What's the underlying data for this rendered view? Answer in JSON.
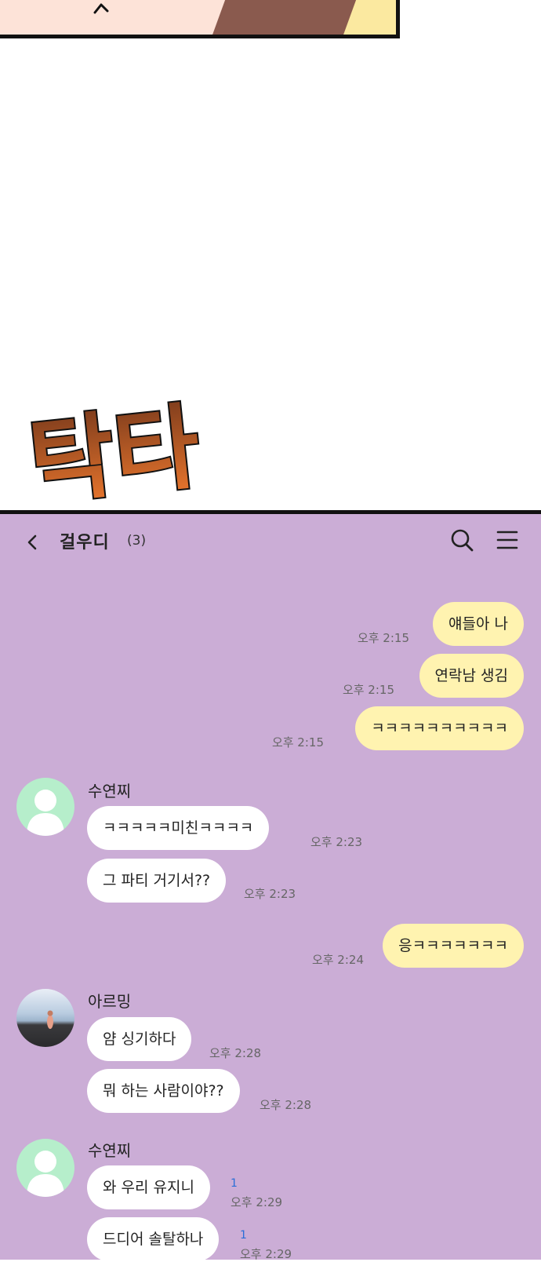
{
  "sfx_text": "탁타",
  "chat": {
    "title": "걸우디",
    "member_count": "(3)"
  },
  "icons": {
    "back": "chevron-left-icon",
    "search": "search-icon",
    "menu": "hamburger-menu-icon"
  },
  "colors": {
    "chat_background": "#cbadd6",
    "my_bubble": "#fff3b0",
    "their_bubble": "#ffffff",
    "unread_count": "#2a6ed8",
    "default_avatar": "#b6eecb"
  },
  "messages": [
    {
      "text": "얘들아 나",
      "time": "오후 2:15"
    },
    {
      "text": "연락남 생김",
      "time": "오후 2:15"
    },
    {
      "text": "ㅋㅋㅋㅋㅋㅋㅋㅋㅋㅋ",
      "time": "오후 2:15"
    },
    {
      "sender": "수연찌",
      "text": "ㅋㅋㅋㅋㅋ미친ㅋㅋㅋㅋ",
      "time": "오후 2:23"
    },
    {
      "text": "그 파티 거기서??",
      "time": "오후 2:23"
    },
    {
      "text": "응ㅋㅋㅋㅋㅋㅋㅋ",
      "time": "오후 2:24"
    },
    {
      "sender": "아르밍",
      "text": "얌 싱기하다",
      "time": "오후 2:28"
    },
    {
      "text": "뭐 하는 사람이야??",
      "time": "오후 2:28"
    },
    {
      "sender": "수연찌",
      "text": "와 우리 유지니",
      "time": "오후 2:29",
      "unread": "1"
    },
    {
      "text": "드디어 솔탈하나",
      "time": "오후 2:29",
      "unread": "1"
    }
  ]
}
